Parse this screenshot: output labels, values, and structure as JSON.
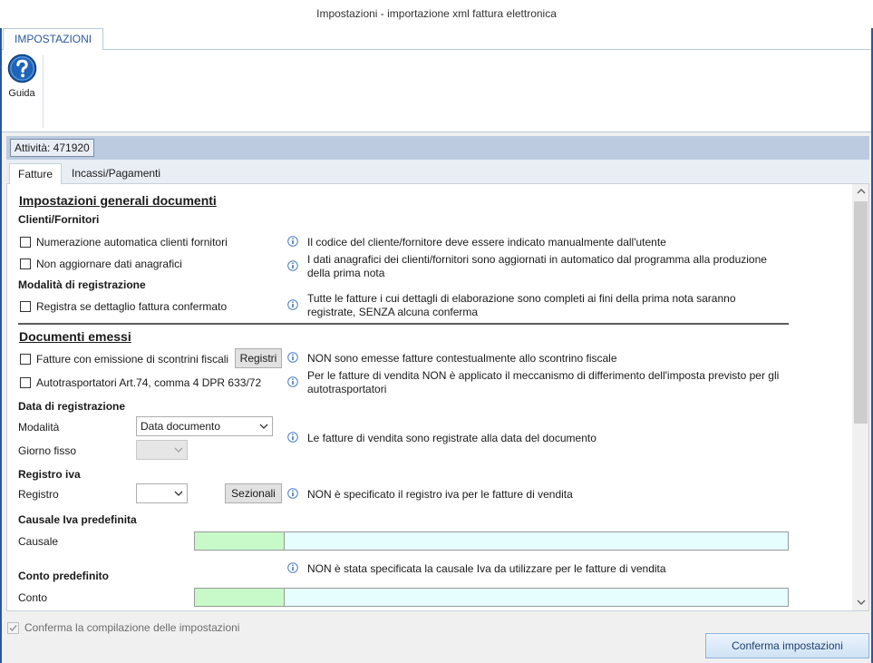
{
  "window": {
    "title": "Impostazioni - importazione xml fattura elettronica"
  },
  "ribbon": {
    "tab_label": "IMPOSTAZIONI",
    "guida_label": "Guida",
    "guida_icon": "help-question-icon"
  },
  "activity": {
    "label": "Attività: 471920"
  },
  "tabs": [
    {
      "label": "Fatture",
      "active": true
    },
    {
      "label": "Incassi/Pagamenti",
      "active": false
    }
  ],
  "generali": {
    "title": "Impostazioni generali documenti",
    "clienti_fornitori": {
      "title": "Clienti/Fornitori",
      "numerazione": {
        "label": "Numerazione automatica clienti fornitori",
        "checked": false,
        "info": "Il codice del cliente/fornitore deve essere indicato manualmente dall'utente"
      },
      "non_aggiornare": {
        "label": "Non aggiornare dati anagrafici",
        "checked": false,
        "info_line1": "I dati anagrafici dei clienti/fornitori sono aggiornati in automatico dal programma alla produzione",
        "info_line2": "della prima nota"
      }
    },
    "modalita_registrazione": {
      "title": "Modalità di registrazione",
      "registra": {
        "label": "Registra se dettaglio fattura confermato",
        "checked": false,
        "info_line1": "Tutte le fatture i cui dettagli di elaborazione sono completi ai fini della prima nota saranno",
        "info_line2": "registrate, SENZA alcuna conferma"
      }
    }
  },
  "emessi": {
    "title": "Documenti emessi",
    "scontrini": {
      "label": "Fatture con emissione di scontrini fiscali",
      "checked": false,
      "button": "Registri",
      "info": "NON sono emesse fatture contestualmente allo scontrino fiscale"
    },
    "autotrasportatori": {
      "label": "Autotrasportatori Art.74, comma 4 DPR 633/72",
      "checked": false,
      "info_line1": "Per le fatture di vendita NON è applicato il meccanismo di differimento dell'imposta previsto per gli",
      "info_line2": "autotrasportatori"
    },
    "data_registrazione": {
      "title": "Data di registrazione",
      "modalita_label": "Modalità",
      "modalita_value": "Data documento",
      "giorno_label": "Giorno fisso",
      "giorno_value": "",
      "info": "Le fatture di vendita sono registrate alla data del documento"
    },
    "registro_iva": {
      "title": "Registro iva",
      "registro_label": "Registro",
      "registro_value": "",
      "button": "Sezionali",
      "info": "NON è specificato il registro iva per le fatture di vendita"
    },
    "causale_iva": {
      "title": "Causale Iva predefinita",
      "causale_label": "Causale",
      "code": "",
      "description": "",
      "info": "NON è stata specificata la causale Iva da utilizzare per le fatture di vendita"
    },
    "conto": {
      "title": "Conto predefinito",
      "conto_label": "Conto",
      "code": "",
      "description": ""
    }
  },
  "footer": {
    "confirm_checkbox_label": "Conferma la compilazione delle impostazioni",
    "confirm_checked": true,
    "confirm_button": "Conferma impostazioni"
  },
  "colors": {
    "accent": "#2b579a",
    "green_field": "#c7f9c9",
    "cyan_field": "#e6fefe",
    "activity_bar": "#bccbe0"
  }
}
